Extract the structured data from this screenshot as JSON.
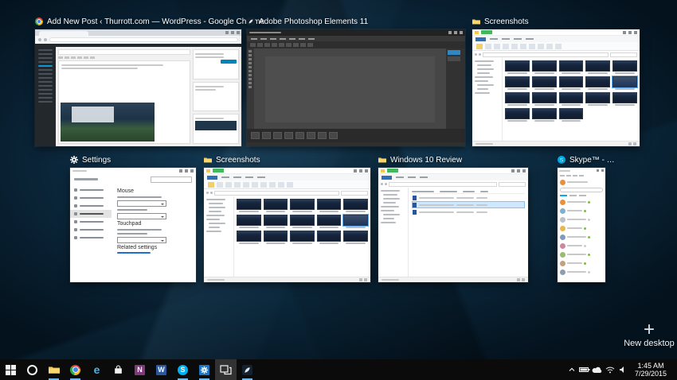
{
  "task_view": {
    "windows": [
      {
        "id": "wordpress-chrome",
        "title": "Add New Post ‹ Thurrott.com — WordPress - Google Chrome"
      },
      {
        "id": "photoshop",
        "title": "Adobe Photoshop Elements 11"
      },
      {
        "id": "screenshots-top",
        "title": "Screenshots"
      },
      {
        "id": "settings",
        "title": "Settings"
      },
      {
        "id": "screenshots-bottom",
        "title": "Screenshots"
      },
      {
        "id": "windows-10-review",
        "title": "Windows 10 Review"
      },
      {
        "id": "skype",
        "title": "Skype™ - …"
      }
    ],
    "new_desktop": {
      "label": "New desktop",
      "plus": "+"
    }
  },
  "settings_window": {
    "mouse_heading": "Mouse",
    "touchpad_heading": "Touchpad",
    "related_heading": "Related settings"
  },
  "taskbar": {
    "glyphs": {
      "edge": "e",
      "onenote": "N",
      "word": "W",
      "skype": "S"
    },
    "clock": {
      "time": "1:45 AM",
      "date": "7/29/2015"
    }
  },
  "colors": {
    "accent": "#0078d7",
    "taskbar_bg": "#0b0b0c",
    "wallpaper_glow": "#16405c",
    "wallpaper_deep": "#04121d",
    "selection": "#66aef0"
  }
}
